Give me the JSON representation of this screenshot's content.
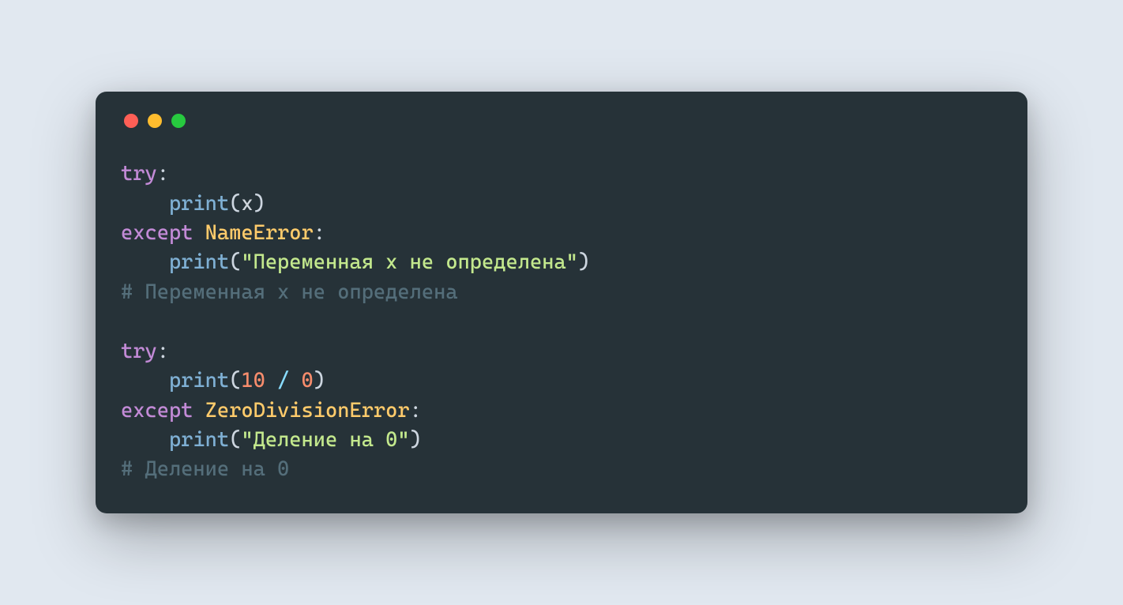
{
  "code": {
    "l1": {
      "try": "try",
      "colon": ":"
    },
    "l2": {
      "indent": "    ",
      "print": "print",
      "lp": "(",
      "x": "x",
      "rp": ")"
    },
    "l3": {
      "except": "except",
      "sp": " ",
      "cls": "NameError",
      "colon": ":"
    },
    "l4": {
      "indent": "    ",
      "print": "print",
      "lp": "(",
      "str": "\"Переменная x не определена\"",
      "rp": ")"
    },
    "l5": {
      "cmt": "# Переменная x не определена"
    },
    "l6": {
      "blank": ""
    },
    "l7": {
      "try": "try",
      "colon": ":"
    },
    "l8": {
      "indent": "    ",
      "print": "print",
      "lp": "(",
      "n1": "10",
      "sp1": " ",
      "op": "/",
      "sp2": " ",
      "n2": "0",
      "rp": ")"
    },
    "l9": {
      "except": "except",
      "sp": " ",
      "cls": "ZeroDivisionError",
      "colon": ":"
    },
    "l10": {
      "indent": "    ",
      "print": "print",
      "lp": "(",
      "str": "\"Деление на 0\"",
      "rp": ")"
    },
    "l11": {
      "cmt": "# Деление на 0"
    }
  }
}
